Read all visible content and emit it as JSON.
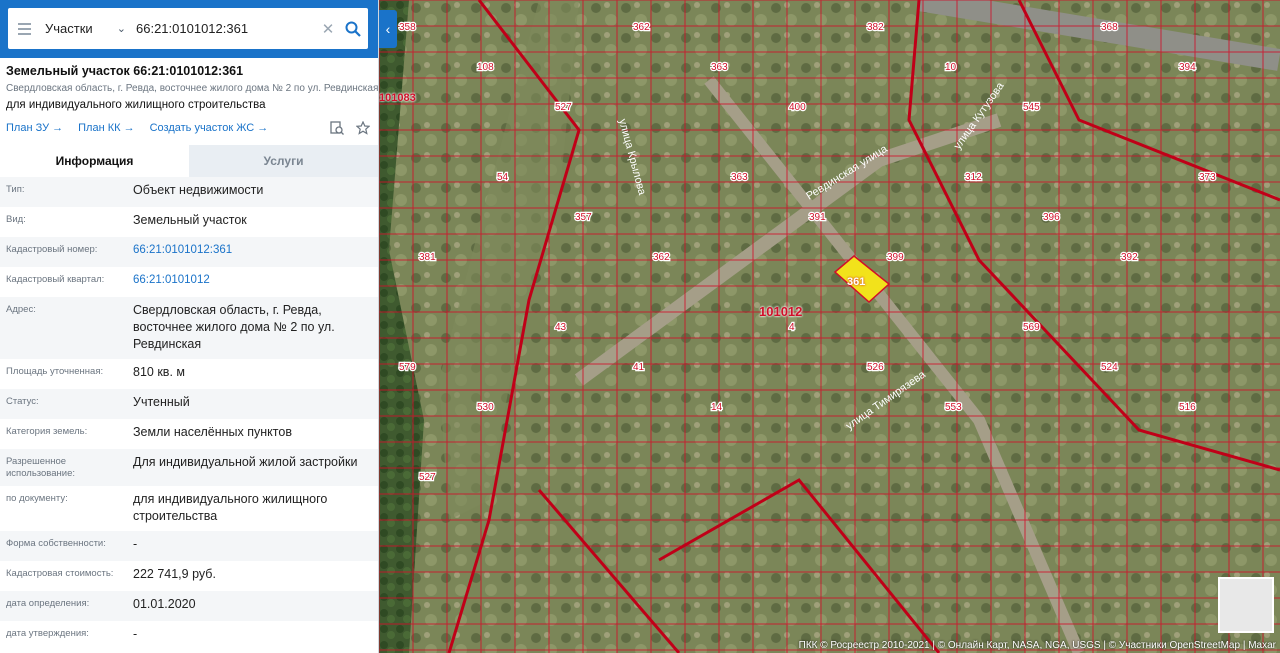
{
  "search": {
    "type_label": "Участки",
    "query": "66:21:0101012:361"
  },
  "object": {
    "title": "Земельный участок 66:21:0101012:361",
    "address_line": "Свердловская область, г. Ревда, восточнее жилого дома № 2 по ул. Ревдинская",
    "purpose": "для индивидуального жилищного строительства"
  },
  "links": {
    "plan_zu": "План ЗУ →",
    "plan_kk": "План КК →",
    "create_zhs": "Создать участок ЖС →"
  },
  "tabs": {
    "info": "Информация",
    "services": "Услуги"
  },
  "info_rows": [
    {
      "label": "Тип:",
      "value": "Объект недвижимости"
    },
    {
      "label": "Вид:",
      "value": "Земельный участок"
    },
    {
      "label": "Кадастровый номер:",
      "value": "66:21:0101012:361"
    },
    {
      "label": "Кадастровый квартал:",
      "value": "66:21:0101012"
    },
    {
      "label": "Адрес:",
      "value": "Свердловская область, г. Ревда, восточнее жилого дома № 2 по ул. Ревдинская"
    },
    {
      "label": "Площадь уточненная:",
      "value": "810 кв. м"
    },
    {
      "label": "Статус:",
      "value": "Учтенный"
    },
    {
      "label": "Категория земель:",
      "value": "Земли населённых пунктов"
    },
    {
      "label": "Разрешенное использование:",
      "value": "Для индивидуальной жилой застройки"
    },
    {
      "label": "по документу:",
      "value": "для индивидуального жилищного строительства"
    },
    {
      "label": "Форма собственности:",
      "value": "-"
    },
    {
      "label": "Кадастровая стоимость:",
      "value": "222 741,9 руб."
    },
    {
      "label": "дата определения:",
      "value": "01.01.2020"
    },
    {
      "label": "дата утверждения:",
      "value": "-"
    }
  ],
  "map": {
    "quarter_label": "101012",
    "selected_parcel_label": "361",
    "block_label": "101083",
    "street_labels": [
      "Ревдинская улица",
      "улица Крылова",
      "улица Кутузова",
      "улица Тимирязева"
    ],
    "parcel_numbers": [
      "358",
      "108",
      "527",
      "362",
      "363",
      "400",
      "382",
      "10",
      "545",
      "368",
      "394",
      "381",
      "54",
      "357",
      "362",
      "363",
      "391",
      "399",
      "312",
      "396",
      "392",
      "373",
      "579",
      "530",
      "43",
      "41",
      "14",
      "4",
      "526",
      "553",
      "569",
      "524",
      "516",
      "527"
    ],
    "attribution": "ПКК © Росреестр 2010-2021 | © Онлайн Карт, NASA, NGA, USGS | © Участники OpenStreetMap | Maxar",
    "colors": {
      "parcel_border": "#d0102a",
      "selected_fill": "#f2e21b",
      "accent": "#1a73c9"
    }
  }
}
